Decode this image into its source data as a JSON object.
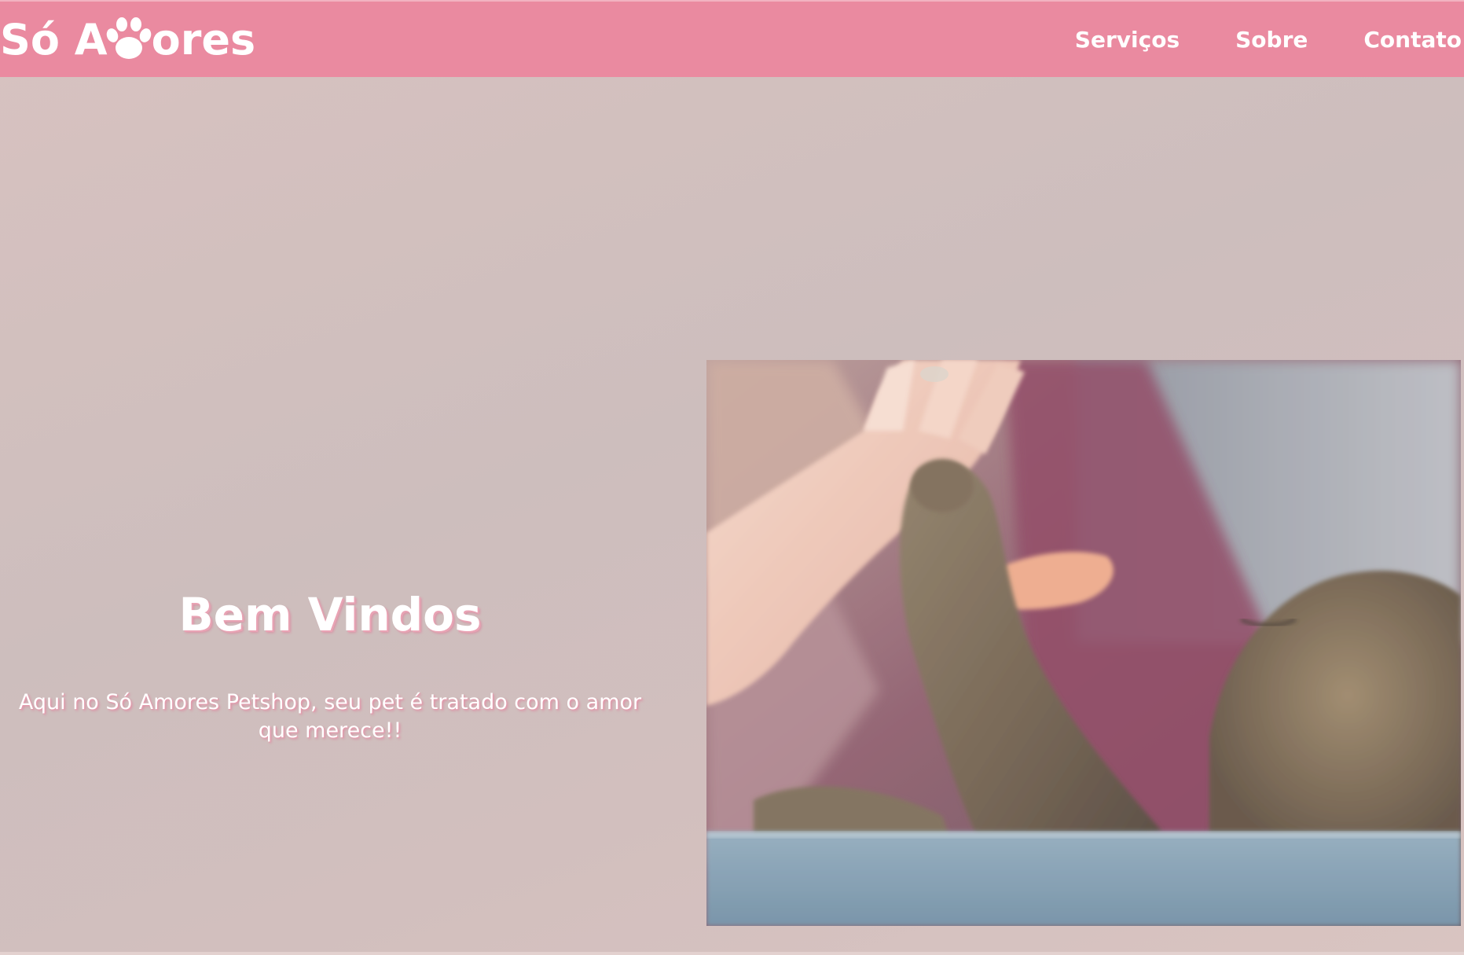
{
  "header": {
    "logo_text_before": "Só A",
    "logo_icon": "paw-icon",
    "logo_text_after": "ores",
    "nav": [
      {
        "label": "Serviços"
      },
      {
        "label": "Sobre"
      },
      {
        "label": "Contato"
      }
    ]
  },
  "hero": {
    "title": "Bem Vindos",
    "subtitle": "Aqui no Só Amores Petshop, seu pet é tratado com o amor que merece!!",
    "image": "photo of a human hand giving a high five to a tabby cat's paw"
  },
  "colors": {
    "header_bg": "#ea8aa0",
    "page_bg": "#d3c0be",
    "text": "#ffffff",
    "text_shadow": "#e9a3b4"
  }
}
